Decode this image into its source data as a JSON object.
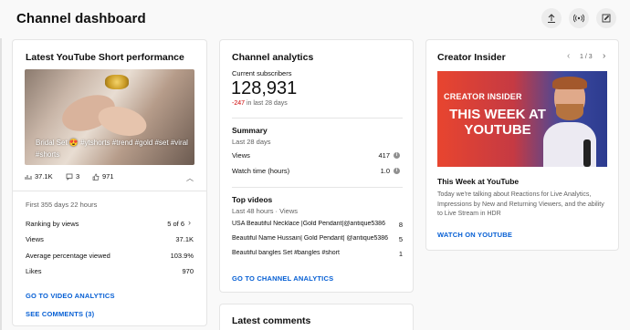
{
  "header": {
    "title": "Channel dashboard",
    "icons": [
      "upload-icon",
      "live-icon",
      "create-post-icon"
    ]
  },
  "short_card": {
    "title": "Latest YouTube Short performance",
    "caption": "Bridal Set 😍 #ytshorts #trend #gold #set #viral #shorts",
    "stats": {
      "views": "37.1K",
      "comments": "3",
      "likes": "971"
    },
    "period": "First 355 days 22 hours",
    "rows": [
      {
        "label": "Ranking by views",
        "value": "5 of 6"
      },
      {
        "label": "Views",
        "value": "37.1K"
      },
      {
        "label": "Average percentage viewed",
        "value": "103.9%"
      },
      {
        "label": "Likes",
        "value": "970"
      }
    ],
    "link_analytics": "GO TO VIDEO ANALYTICS",
    "link_comments": "SEE COMMENTS (3)"
  },
  "analytics_card": {
    "title": "Channel analytics",
    "subs_label": "Current subscribers",
    "subs_value": "128,931",
    "subs_delta": "-247",
    "subs_delta_suffix": " in last 28 days",
    "summary_title": "Summary",
    "summary_period": "Last 28 days",
    "summary_rows": [
      {
        "label": "Views",
        "value": "417"
      },
      {
        "label": "Watch time (hours)",
        "value": "1.0"
      }
    ],
    "top_title": "Top videos",
    "top_period": "Last 48 hours · Views",
    "top_videos": [
      {
        "title": "USA Beautiful Necklace |Gold Pendant|@antique5386",
        "views": "8"
      },
      {
        "title": "Beautiful Name Hussain| Gold Pendant| @antique5386 ...",
        "views": "5"
      },
      {
        "title": "Beautiful bangles Set #bangles #short",
        "views": "1"
      }
    ],
    "link": "GO TO CHANNEL ANALYTICS"
  },
  "comments_card": {
    "title": "Latest comments"
  },
  "insider_card": {
    "title": "Creator Insider",
    "pager": "1 / 3",
    "promo_head": "CREATOR INSIDER",
    "promo_sub": "THIS WEEK AT YOUTUBE",
    "video_title": "This Week at YouTube",
    "description": "Today we're talking about Reactions for Live Analytics, Impressions by New and Returning Viewers, and the ability to Live Stream in HDR",
    "link": "WATCH ON YOUTUBE"
  },
  "colors": {
    "link": "#065fd4",
    "negative": "#cc0000",
    "promo_left": "#e8452f",
    "promo_right": "#2c3b8f"
  }
}
